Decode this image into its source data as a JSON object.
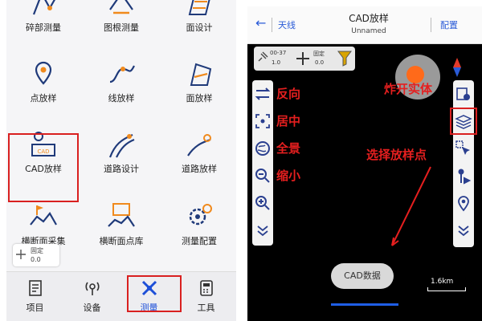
{
  "left_panel": {
    "grid": [
      {
        "label": "碎部测量",
        "icon": "survey-points-icon"
      },
      {
        "label": "图根测量",
        "icon": "control-survey-icon"
      },
      {
        "label": "面设计",
        "icon": "area-design-icon"
      },
      {
        "label": "点放样",
        "icon": "point-stakeout-icon"
      },
      {
        "label": "线放样",
        "icon": "line-stakeout-icon"
      },
      {
        "label": "面放样",
        "icon": "area-stakeout-icon"
      },
      {
        "label": "CAD放样",
        "icon": "cad-stakeout-icon"
      },
      {
        "label": "道路设计",
        "icon": "road-design-icon"
      },
      {
        "label": "道路放样",
        "icon": "road-stakeout-icon"
      },
      {
        "label": "横断面采集",
        "icon": "cross-section-collect-icon"
      },
      {
        "label": "横断面点库",
        "icon": "cross-section-library-icon"
      },
      {
        "label": "测量配置",
        "icon": "survey-config-icon"
      }
    ],
    "gps_badge": {
      "line1": "固定",
      "line2": "0.0"
    },
    "tabs": [
      {
        "label": "项目",
        "icon": "project-icon"
      },
      {
        "label": "设备",
        "icon": "device-icon"
      },
      {
        "label": "测量",
        "icon": "survey-icon"
      },
      {
        "label": "工具",
        "icon": "tools-icon"
      }
    ],
    "active_tab": "测量",
    "highlight_color": "#d92020"
  },
  "right_panel": {
    "back_label": "←",
    "antenna_label": "天线",
    "title": "CAD放样",
    "subtitle": "Unnamed",
    "config_label": "配置",
    "status": {
      "sat": "00-37",
      "sat2": "1.0",
      "fix_label": "固定",
      "fix_value": "0.0"
    },
    "left_tools": [
      {
        "icon": "reverse-icon",
        "annotation": "反向"
      },
      {
        "icon": "center-icon",
        "annotation": "居中"
      },
      {
        "icon": "fullview-icon",
        "annotation": "全景"
      },
      {
        "icon": "zoom-out-icon",
        "annotation": "缩小"
      },
      {
        "icon": "zoom-in-icon"
      },
      {
        "icon": "collapse-icon"
      }
    ],
    "right_tools": [
      {
        "icon": "explode-entity-icon"
      },
      {
        "icon": "layers-icon"
      },
      {
        "icon": "select-point-icon"
      },
      {
        "icon": "stake-point-icon"
      },
      {
        "icon": "location-pin-icon"
      },
      {
        "icon": "collapse-icon"
      }
    ],
    "annotation_explode": "炸开实体",
    "annotation_select": "选择放样点",
    "cad_data_button": "CAD数据",
    "scale_label": "1.6km",
    "annotation_color": "#e51f1f",
    "accent_color": "#2a5bd7"
  }
}
